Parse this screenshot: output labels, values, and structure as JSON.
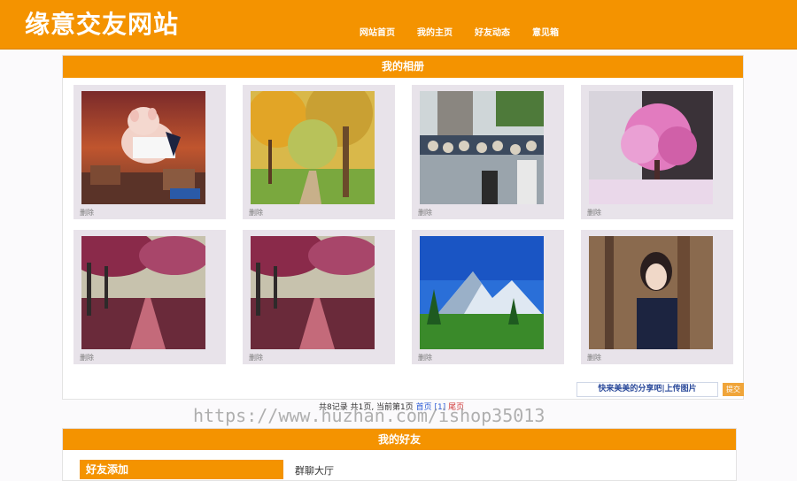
{
  "header": {
    "logo": "缘意交友网站",
    "nav": [
      "网站首页",
      "我的主页",
      "好友动态",
      "意见箱"
    ]
  },
  "album": {
    "title": "我的相册",
    "photos": [
      {
        "subject": "pig",
        "delete_label": "删除"
      },
      {
        "subject": "autumn-trees",
        "delete_label": "删除"
      },
      {
        "subject": "crowd",
        "delete_label": "删除"
      },
      {
        "subject": "pink-tree",
        "delete_label": "删除"
      },
      {
        "subject": "red-path",
        "delete_label": "删除"
      },
      {
        "subject": "red-path",
        "delete_label": "删除"
      },
      {
        "subject": "mountains",
        "delete_label": "删除"
      },
      {
        "subject": "girl-portrait",
        "delete_label": "删除"
      }
    ],
    "share_button": "快来美美的分享吧|上传图片",
    "submit_button": "提交"
  },
  "pager": {
    "summary": "共8记录 共1页, 当前第1页",
    "first": "首页",
    "current": "[1]",
    "last": "尾页"
  },
  "watermark": "https://www.huzhan.com/ishop35013",
  "friends": {
    "title": "我的好友",
    "add_label": "好友添加",
    "chat_hall": "群聊大厅"
  },
  "colors": {
    "accent": "#f49300",
    "link": "#2b5bd6"
  }
}
